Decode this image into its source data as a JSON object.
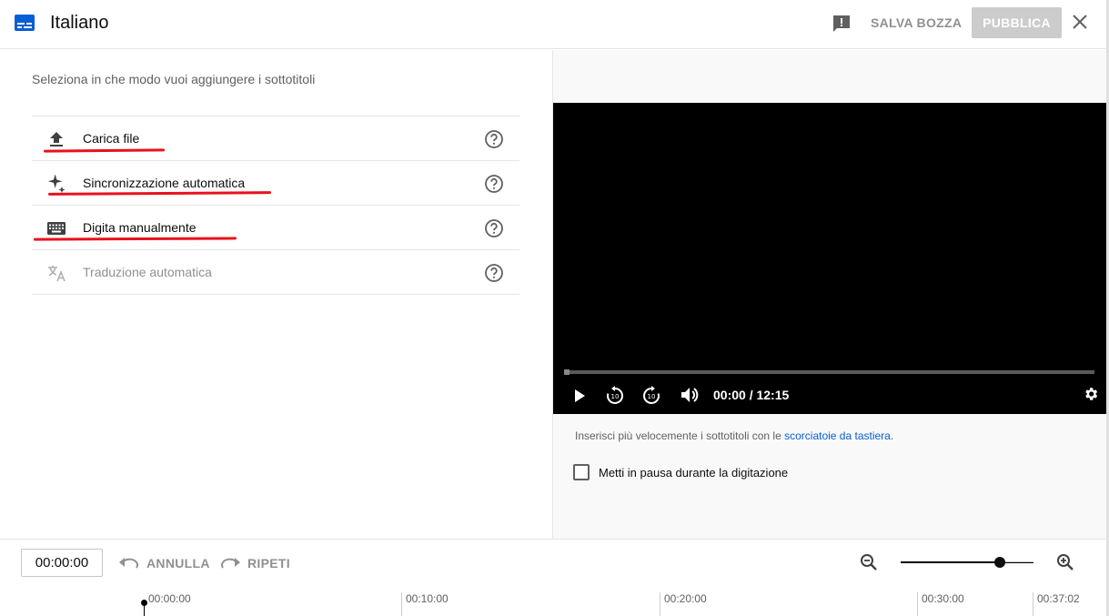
{
  "header": {
    "title": "Italiano",
    "save_draft": "SALVA BOZZA",
    "publish": "PUBBLICA",
    "icons": {
      "logo": "subtitles-icon",
      "feedback": "feedback-icon",
      "close": "close-icon"
    }
  },
  "left": {
    "intro": "Seleziona in che modo vuoi aggiungere i sottotitoli",
    "options": [
      {
        "label": "Carica file",
        "icon": "upload-icon",
        "enabled": true
      },
      {
        "label": "Sincronizzazione automatica",
        "icon": "sparkle-icon",
        "enabled": true
      },
      {
        "label": "Digita manualmente",
        "icon": "keyboard-icon",
        "enabled": true
      },
      {
        "label": "Traduzione automatica",
        "icon": "translate-icon",
        "enabled": false
      }
    ]
  },
  "player": {
    "time": "00:00 / 12:15",
    "hint_text": "Inserisci più velocemente i sottotitoli con le ",
    "hint_link": "scorciatoie da tastiera",
    "hint_end": ".",
    "pause_label": "Metti in pausa durante la digitazione",
    "pause_checked": false
  },
  "bottom": {
    "current_time": "00:00:00",
    "undo": "ANNULLA",
    "redo": "RIPETI",
    "timeline_labels": [
      "00:00:00",
      "00:10:00",
      "00:20:00",
      "00:30:00",
      "00:37:02"
    ]
  },
  "colors": {
    "annotation_red": "#e8121c",
    "link_blue": "#065fd4",
    "logo_blue": "#065fd4"
  }
}
